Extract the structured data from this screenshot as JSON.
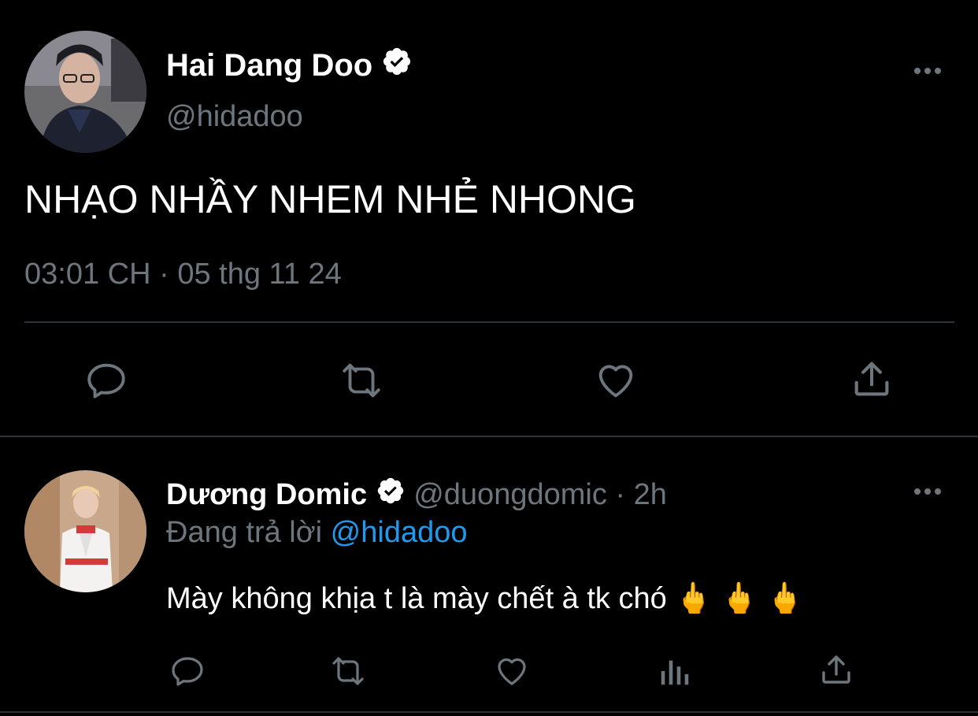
{
  "main_tweet": {
    "author_name": "Hai Dang Doo",
    "handle": "@hidadoo",
    "text": "NHẠO NHẦY NHEM NHẺ NHONG",
    "time": "03:01 CH",
    "separator": "·",
    "date": "05 thg 11 24",
    "actions": [
      "reply-icon",
      "retweet-icon",
      "like-icon",
      "share-icon"
    ]
  },
  "reply_tweet": {
    "author_name": "Dương Domic",
    "handle": "@duongdomic",
    "separator": "·",
    "age": "2h",
    "replying_prefix": "Đang trả lời",
    "replying_to": "@hidadoo",
    "text": "Mày không khịa t là mày chết à tk chó 🖕 🖕 🖕",
    "actions": [
      "reply-icon",
      "retweet-icon",
      "like-icon",
      "analytics-icon",
      "share-icon"
    ]
  },
  "colors": {
    "background": "#000000",
    "text": "#e7e9ea",
    "muted": "#6e767d",
    "link": "#1d9bf0",
    "divider": "#2f3336"
  }
}
